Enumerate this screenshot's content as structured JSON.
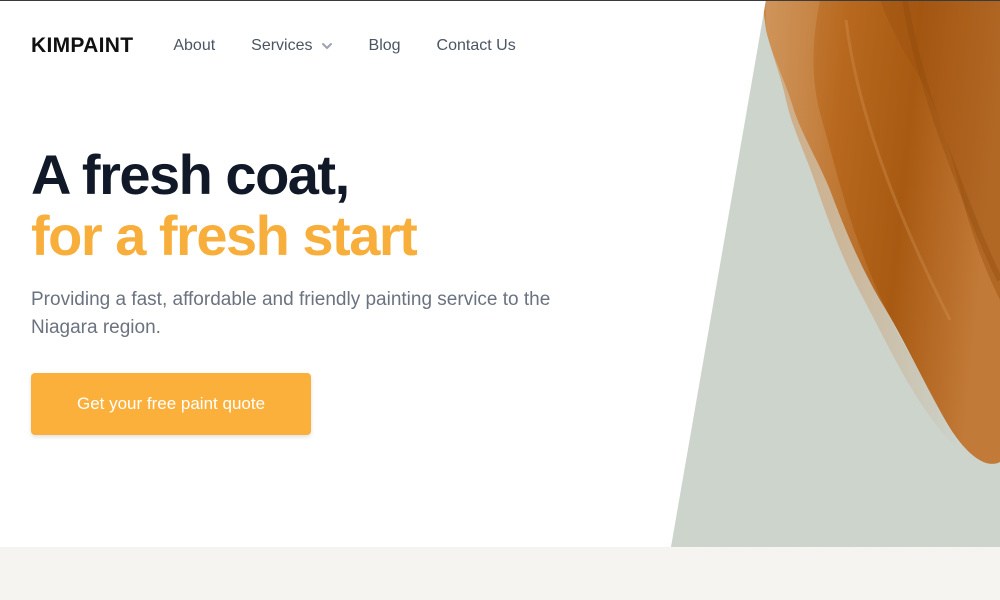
{
  "brand": {
    "name": "KIMPAINT"
  },
  "nav": {
    "items": [
      {
        "label": "About",
        "has_dropdown": false
      },
      {
        "label": "Services",
        "has_dropdown": true,
        "icon": "chevron-down-icon"
      },
      {
        "label": "Blog",
        "has_dropdown": false
      },
      {
        "label": "Contact Us",
        "has_dropdown": false
      }
    ]
  },
  "hero": {
    "headline_line1": "A fresh coat,",
    "headline_line2": "for a fresh start",
    "subtitle": "Providing a fast, affordable and friendly painting service to the Niagara region.",
    "cta_label": "Get your free paint quote",
    "image": "paint-brush-stroke-canvas"
  },
  "colors": {
    "accent": "#fbb03b",
    "headline_dark": "#111827",
    "text_muted": "#6b7280",
    "canvas": "#cfd6cf",
    "paint": "#b8631c",
    "lower_band": "#f5f4f0"
  }
}
